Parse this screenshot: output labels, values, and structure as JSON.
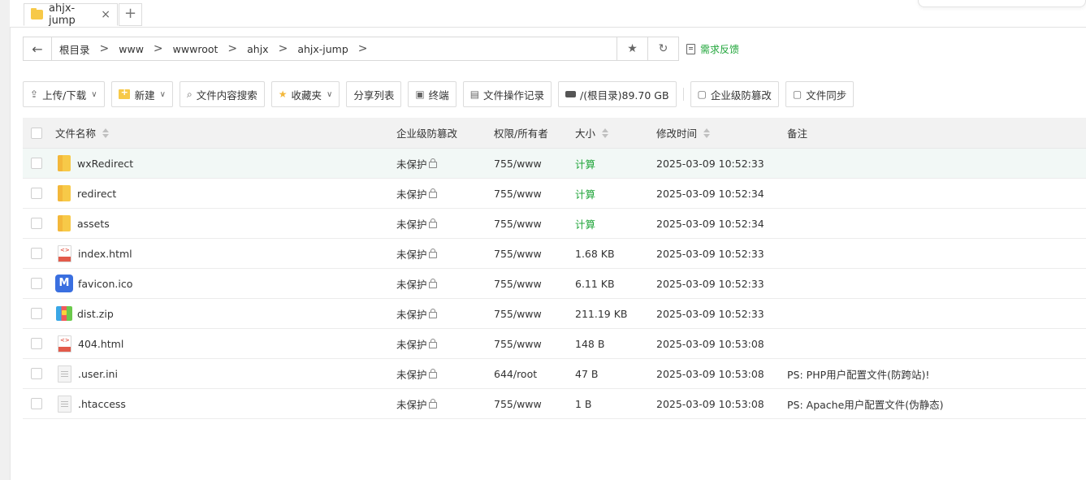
{
  "tab": {
    "label": "ahjx-jump",
    "close": "×",
    "add": "+"
  },
  "path": {
    "back": "←",
    "crumbs": [
      "根目录",
      "www",
      "wwwroot",
      "ahjx",
      "ahjx-jump"
    ],
    "sep": ">",
    "star": "★",
    "refresh": "↻",
    "feedback": "需求反馈"
  },
  "toolbar": {
    "upload": "上传/下载",
    "new": "新建",
    "search_content": "文件内容搜索",
    "favorites": "收藏夹",
    "share_list": "分享列表",
    "terminal": "终端",
    "op_log": "文件操作记录",
    "disk": "/(根目录)89.70 GB",
    "protect": "企业级防篡改",
    "sync": "文件同步"
  },
  "table": {
    "headers": {
      "name": "文件名称",
      "protect": "企业级防篡改",
      "perm": "权限/所有者",
      "size": "大小",
      "mtime": "修改时间",
      "note": "备注"
    },
    "rows": [
      {
        "icon": "folder-icon",
        "name": "wxRedirect",
        "protect": "未保护",
        "perm": "755/www",
        "size": "计算",
        "mtime": "2025-03-09 10:52:33",
        "note": ""
      },
      {
        "icon": "folder-icon",
        "name": "redirect",
        "protect": "未保护",
        "perm": "755/www",
        "size": "计算",
        "mtime": "2025-03-09 10:52:34",
        "note": ""
      },
      {
        "icon": "folder-icon",
        "name": "assets",
        "protect": "未保护",
        "perm": "755/www",
        "size": "计算",
        "mtime": "2025-03-09 10:52:34",
        "note": ""
      },
      {
        "icon": "html-file-icon",
        "name": "index.html",
        "protect": "未保护",
        "perm": "755/www",
        "size": "1.68 KB",
        "mtime": "2025-03-09 10:52:33",
        "note": ""
      },
      {
        "icon": "ico-file-icon",
        "name": "favicon.ico",
        "protect": "未保护",
        "perm": "755/www",
        "size": "6.11 KB",
        "mtime": "2025-03-09 10:52:33",
        "note": ""
      },
      {
        "icon": "zip-file-icon",
        "name": "dist.zip",
        "protect": "未保护",
        "perm": "755/www",
        "size": "211.19 KB",
        "mtime": "2025-03-09 10:52:33",
        "note": ""
      },
      {
        "icon": "html-file-icon",
        "name": "404.html",
        "protect": "未保护",
        "perm": "755/www",
        "size": "148 B",
        "mtime": "2025-03-09 10:53:08",
        "note": ""
      },
      {
        "icon": "text-file-icon",
        "name": ".user.ini",
        "protect": "未保护",
        "perm": "644/root",
        "size": "47 B",
        "mtime": "2025-03-09 10:53:08",
        "note": "PS: PHP用户配置文件(防跨站)!"
      },
      {
        "icon": "text-file-icon",
        "name": ".htaccess",
        "protect": "未保护",
        "perm": "755/www",
        "size": "1 B",
        "mtime": "2025-03-09 10:53:08",
        "note": "PS: Apache用户配置文件(伪静态)"
      }
    ]
  },
  "colors": {
    "accent": "#20a53a",
    "folder": "#f7c948",
    "highlight_row": "#f2f8f6"
  }
}
